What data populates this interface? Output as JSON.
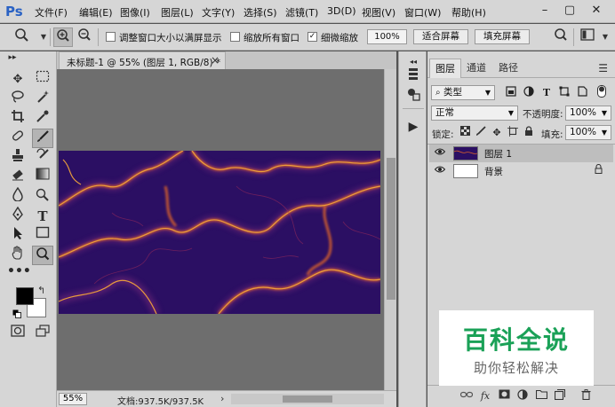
{
  "app": {
    "logo_text": "Ps",
    "brand_color": "#2a62c4"
  },
  "menu": {
    "items": [
      "文件(F)",
      "编辑(E)",
      "图像(I)",
      "图层(L)",
      "文字(Y)",
      "选择(S)",
      "滤镜(T)",
      "3D(D)",
      "视图(V)",
      "窗口(W)",
      "帮助(H)"
    ],
    "window_controls": [
      "–",
      "▢",
      "✕"
    ]
  },
  "options_bar": {
    "resize_windows_label": "调整窗口大小以满屏显示",
    "resize_windows_checked": false,
    "zoom_all_label": "缩放所有窗口",
    "zoom_all_checked": false,
    "scrubby_zoom_label": "细微缩放",
    "scrubby_zoom_checked": true,
    "zoom_value": "100%",
    "fit_screen_label": "适合屏幕",
    "fill_screen_label": "填充屏幕"
  },
  "document": {
    "tab_label": "未标题-1 @ 55% (图层 1, RGB/8) *",
    "tab_close": "×",
    "zoom_status": "55%",
    "doc_size": "文档:937.5K/937.5K",
    "status_arrow": "›",
    "artwork_bg": "#2b0f63",
    "artwork_vein_colors": [
      "#f1a33a",
      "#d9622a",
      "#a52d5a"
    ]
  },
  "layers_panel": {
    "tabs": [
      "图层",
      "通道",
      "路径"
    ],
    "active_tab": "图层",
    "filter_type": "类型",
    "blend_mode": "正常",
    "opacity_label": "不透明度:",
    "opacity_value": "100%",
    "lock_label": "锁定:",
    "fill_label": "填充:",
    "fill_value": "100%",
    "layers": [
      {
        "name": "图层 1",
        "selected": true,
        "visible": true,
        "locked": false
      },
      {
        "name": "背景",
        "selected": false,
        "visible": true,
        "locked": true
      }
    ]
  },
  "watermark": {
    "title": "百科全说",
    "subtitle": "助你轻松解决"
  }
}
